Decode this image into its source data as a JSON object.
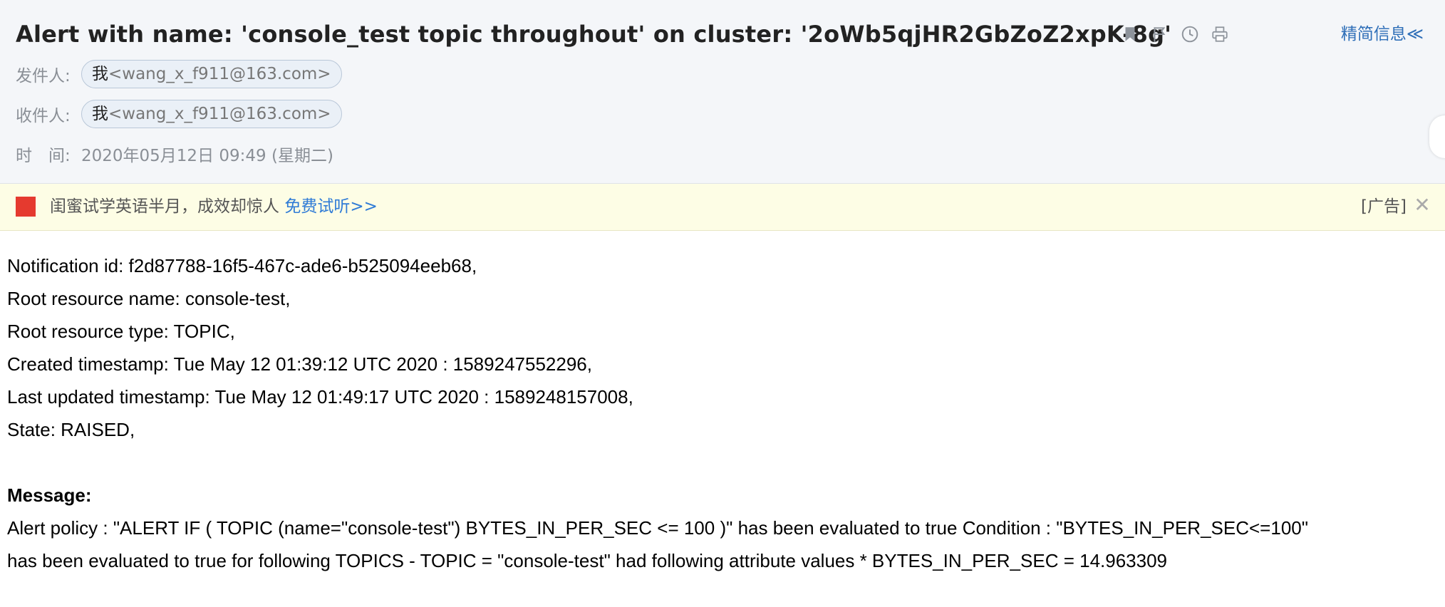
{
  "header": {
    "subject": "Alert with name: 'console_test topic throughout' on cluster: '2oWb5qjHR2GbZoZ2xpK-8g'",
    "brief_link": "精简信息≪",
    "tools": [
      "bookmark-icon",
      "flag-icon",
      "clock-icon",
      "print-icon"
    ],
    "sender": {
      "label": "发件人:",
      "me": "我",
      "address": "<wang_x_f911@163.com>"
    },
    "recipient": {
      "label": "收件人:",
      "me": "我",
      "address": "<wang_x_f911@163.com>"
    },
    "time": {
      "label": "时　间:",
      "value": "2020年05月12日 09:49 (星期二)"
    }
  },
  "ad": {
    "text": "闺蜜试学英语半月，成效却惊人",
    "link": "免费试听>>",
    "tag": "[广告]",
    "close": "✕"
  },
  "body": {
    "lines": [
      "Notification id: f2d87788-16f5-467c-ade6-b525094eeb68,",
      "Root resource name: console-test,",
      "Root resource type: TOPIC,",
      "Created timestamp: Tue May 12 01:39:12 UTC 2020 : 1589247552296,",
      "Last updated timestamp: Tue May 12 01:49:17 UTC 2020 : 1589248157008,",
      "State: RAISED,"
    ],
    "message_title": "Message:",
    "message_line1": "Alert policy : \"ALERT IF ( TOPIC (name=\"console-test\") BYTES_IN_PER_SEC <= 100 )\" has been evaluated to true Condition : \"BYTES_IN_PER_SEC<=100\"",
    "message_line2": "has been evaluated to true for following TOPICS - TOPIC = \"console-test\" had following attribute values * BYTES_IN_PER_SEC = 14.963309"
  },
  "colors": {
    "header_bg": "#f4f6f9",
    "ad_bg": "#fdfde5",
    "link": "#2f7bd6"
  }
}
